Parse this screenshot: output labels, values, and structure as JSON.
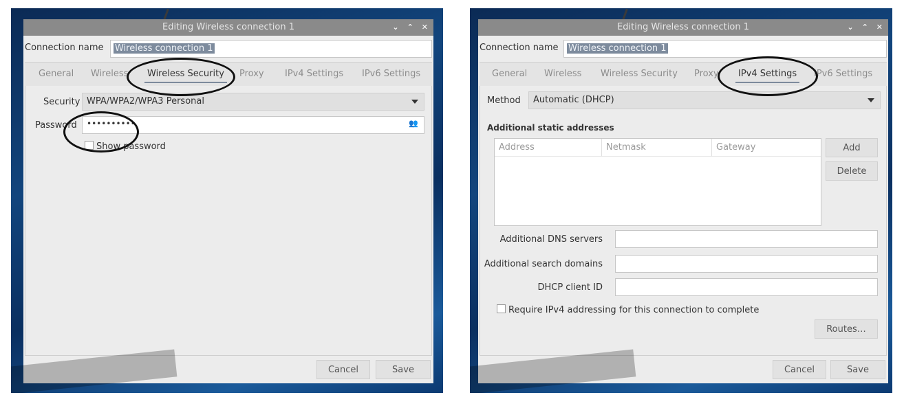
{
  "left": {
    "title": "Editing Wireless connection 1",
    "connection_name_label": "Connection name",
    "connection_name_value": "Wireless connection 1",
    "tabs": [
      "General",
      "Wireless",
      "Wireless Security",
      "Proxy",
      "IPv4 Settings",
      "IPv6 Settings"
    ],
    "active_tab": "Wireless Security",
    "security_label": "Security",
    "security_value": "WPA/WPA2/WPA3 Personal",
    "password_label": "Password",
    "password_value": "••••••••••",
    "show_password_label": "Show password",
    "cancel": "Cancel",
    "save": "Save"
  },
  "right": {
    "title": "Editing Wireless connection 1",
    "connection_name_label": "Connection name",
    "connection_name_value": "Wireless connection 1",
    "tabs": [
      "General",
      "Wireless",
      "Wireless Security",
      "Proxy",
      "IPv4 Settings",
      "IPv6 Settings"
    ],
    "active_tab": "IPv4 Settings",
    "method_label": "Method",
    "method_value": "Automatic (DHCP)",
    "static_heading": "Additional static addresses",
    "columns": [
      "Address",
      "Netmask",
      "Gateway"
    ],
    "add": "Add",
    "delete": "Delete",
    "dns_label": "Additional DNS servers",
    "search_label": "Additional search domains",
    "dhcp_label": "DHCP client ID",
    "require_label": "Require IPv4 addressing for this connection to complete",
    "routes": "Routes…",
    "cancel": "Cancel",
    "save": "Save"
  },
  "icons": {
    "window_controls": [
      "minimize-icon",
      "maximize-icon",
      "close-icon"
    ],
    "password_storage": "users-icon"
  },
  "colors": {
    "selection": "#7d8b9d",
    "titlebar": "#8a8a8a",
    "annotation_ring": "#111111"
  }
}
